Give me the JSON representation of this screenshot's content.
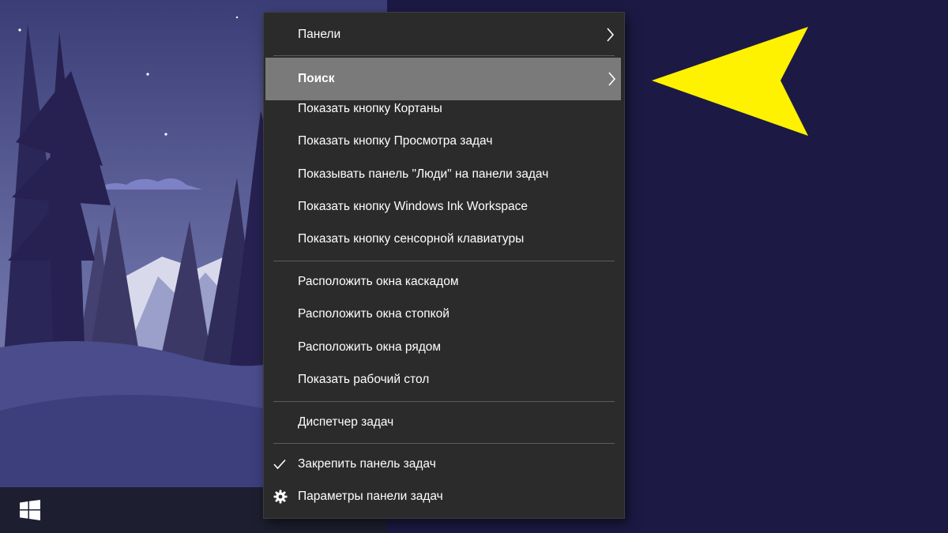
{
  "context_menu": {
    "items": [
      {
        "label": "Панели",
        "has_submenu": true
      },
      {
        "label": "Поиск",
        "has_submenu": true,
        "highlighted": true
      },
      {
        "label": "Показать кнопку Кортаны"
      },
      {
        "label": "Показать кнопку Просмотра задач"
      },
      {
        "label": "Показывать панель \"Люди\" на панели задач"
      },
      {
        "label": "Показать кнопку Windows Ink Workspace"
      },
      {
        "label": "Показать кнопку сенсорной клавиатуры"
      },
      {
        "label": "Расположить окна каскадом"
      },
      {
        "label": "Расположить окна стопкой"
      },
      {
        "label": "Расположить окна рядом"
      },
      {
        "label": "Показать рабочий стол"
      },
      {
        "label": "Диспетчер задач"
      },
      {
        "label": "Закрепить панель задач",
        "checked": true,
        "icon": "checkmark-icon"
      },
      {
        "label": "Параметры панели задач",
        "icon": "gear-icon"
      }
    ]
  },
  "taskbar": {
    "start_icon": "windows-logo-icon"
  },
  "annotation": {
    "icon": "yellow-arrow-pointer",
    "color": "#fff200"
  },
  "colors": {
    "menu_background": "#2b2b2b",
    "highlight": "#7a7a7a",
    "separator": "#5c5c5c",
    "desktop_background": "#1c1a45"
  }
}
